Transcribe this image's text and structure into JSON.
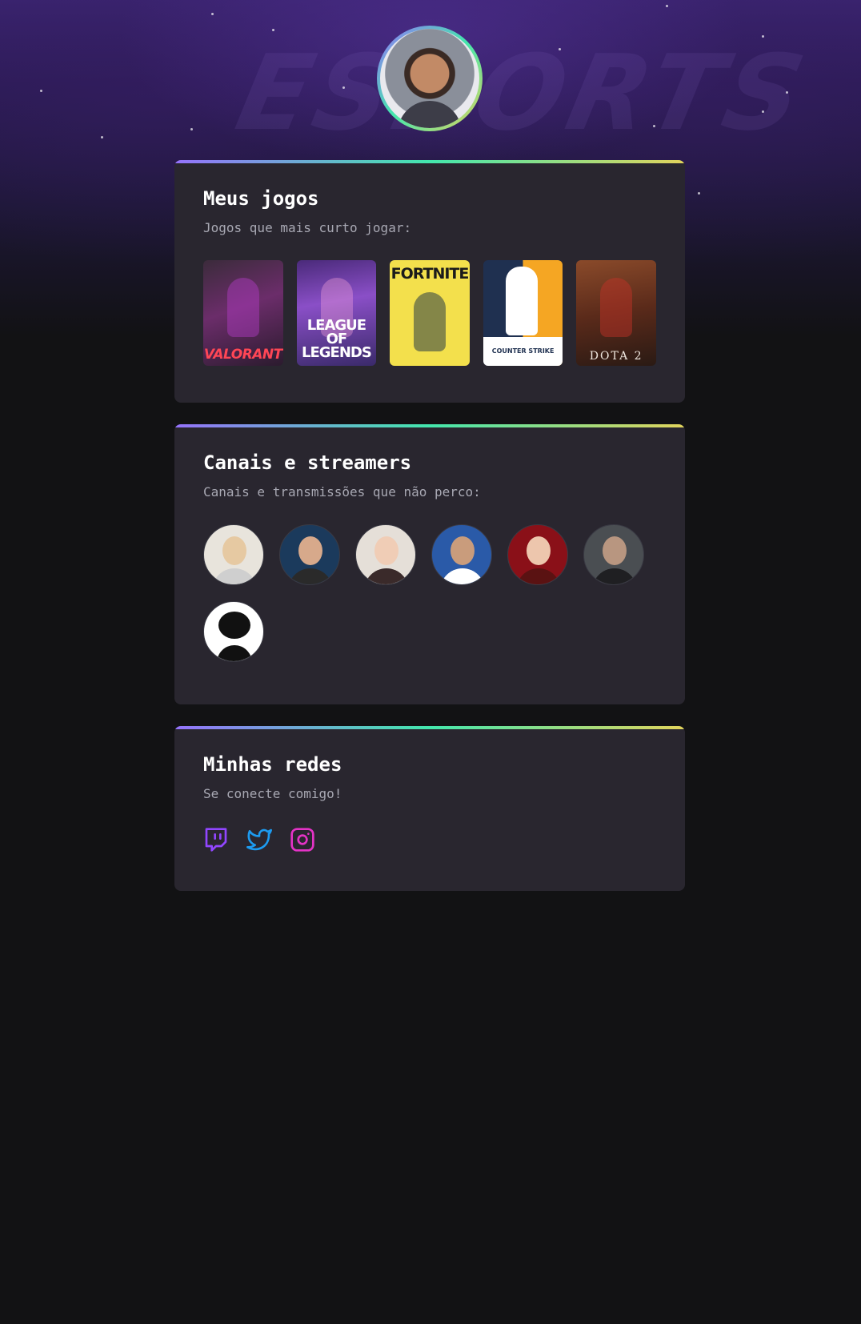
{
  "profile": {
    "avatar_icon": "profile-photo"
  },
  "background": {
    "watermark": "ESPORTS"
  },
  "games_card": {
    "title": "Meus jogos",
    "subtitle": "Jogos que mais curto jogar:",
    "games": [
      {
        "name": "VALORANT"
      },
      {
        "name": "LEAGUE OF LEGENDS"
      },
      {
        "name": "FORTNITE"
      },
      {
        "name": "COUNTER STRIKE"
      },
      {
        "name": "DOTA 2"
      }
    ]
  },
  "streamers_card": {
    "title": "Canais e streamers",
    "subtitle": "Canais e transmissões que não perco:",
    "count": 7
  },
  "socials_card": {
    "title": "Minhas redes",
    "subtitle": "Se conecte comigo!",
    "links": [
      {
        "icon": "twitch-icon",
        "color": "#9146ff"
      },
      {
        "icon": "twitter-icon",
        "color": "#1d9bf0"
      },
      {
        "icon": "instagram-icon",
        "color": "#e433c6"
      }
    ]
  },
  "colors": {
    "background": "#121214",
    "card": "#29262f",
    "gradient": [
      "#9572fc",
      "#43e7ad",
      "#e2d45c"
    ],
    "title": "#ffffff",
    "subtitle": "#a8a8b3"
  }
}
